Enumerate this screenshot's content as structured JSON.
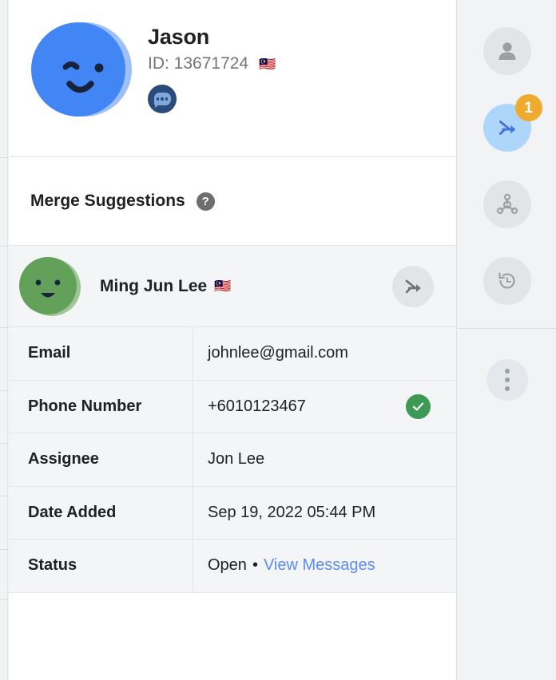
{
  "colors": {
    "avatar_primary": "#4285f4",
    "avatar_primary_light": "#9cc0f7",
    "avatar_suggest": "#63a05a",
    "avatar_suggest_light": "#9cc795",
    "accent_link": "#5b8def",
    "verified_green": "#3d9a54",
    "badge_orange": "#efab30",
    "rail_active": "#aed6fb",
    "merge_arrow_blue": "#4273d8",
    "panel_bg": "#ffffff",
    "table_bg": "#f4f5f6",
    "rail_bg": "#f1f3f4"
  },
  "profile": {
    "avatar_icon": "smiley-avatar-blue",
    "name": "Jason",
    "id_label": "ID: 13671724",
    "country_flag": "🇲🇾",
    "channel_icon": "messenger-chat-icon"
  },
  "merge_suggestions": {
    "title": "Merge Suggestions",
    "help_icon": "help-question-icon",
    "help_glyph": "?",
    "items": [
      {
        "avatar_icon": "smiley-avatar-green",
        "name": "Ming Jun Lee",
        "country_flag": "🇲🇾",
        "action_icon": "merge-arrows-icon"
      }
    ]
  },
  "details": {
    "rows": [
      {
        "label": "Email",
        "value": "johnlee@gmail.com",
        "verified": false
      },
      {
        "label": "Phone Number",
        "value": "+6010123467",
        "verified": true,
        "verified_icon": "check-circle-icon"
      },
      {
        "label": "Assignee",
        "value": "Jon Lee",
        "verified": false
      },
      {
        "label": "Date Added",
        "value": "Sep 19, 2022 05:44 PM",
        "verified": false
      }
    ],
    "status_row": {
      "label": "Status",
      "value": "Open",
      "separator": "•",
      "link_label": "View Messages"
    }
  },
  "rail": {
    "buttons": [
      {
        "name": "profile",
        "icon": "person-icon",
        "active": false,
        "badge": null
      },
      {
        "name": "merge",
        "icon": "merge-arrows-icon",
        "active": true,
        "badge": "1"
      },
      {
        "name": "relationships",
        "icon": "network-nodes-icon",
        "active": false,
        "badge": null
      },
      {
        "name": "history",
        "icon": "history-restore-icon",
        "active": false,
        "badge": null
      }
    ],
    "more_button": {
      "icon": "more-vertical-icon"
    }
  }
}
